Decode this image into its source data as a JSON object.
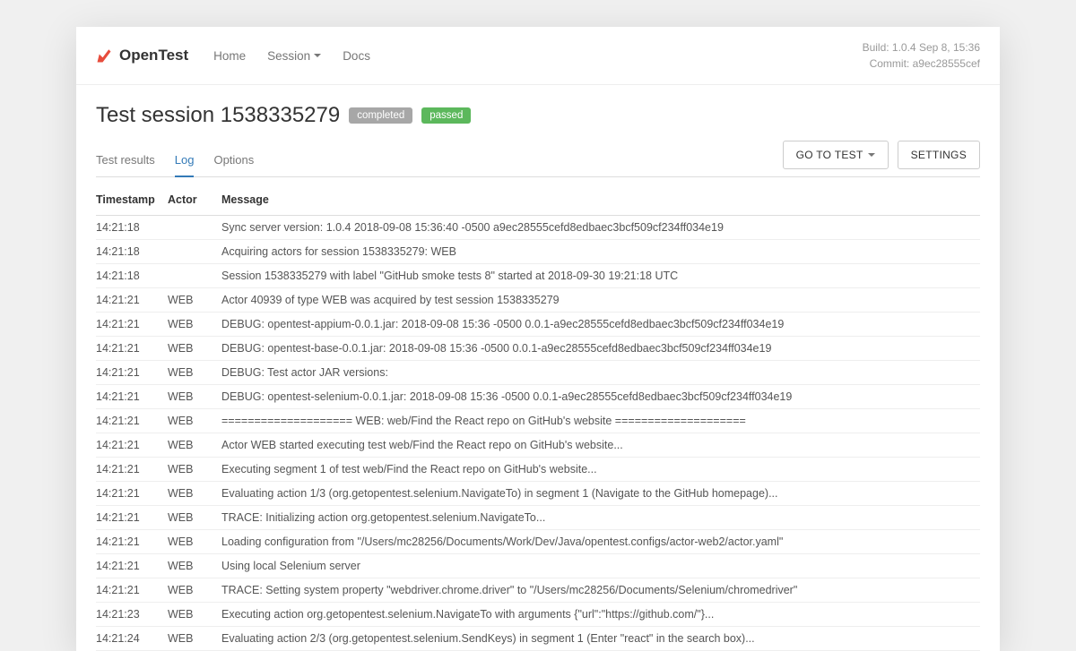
{
  "brand": "OpenTest",
  "nav": {
    "home": "Home",
    "session": "Session",
    "docs": "Docs"
  },
  "meta": {
    "build": "Build: 1.0.4 Sep 8, 15:36",
    "commit": "Commit: a9ec28555cef"
  },
  "title": "Test session 1538335279",
  "badges": {
    "completed": "completed",
    "passed": "passed"
  },
  "tabs": {
    "results": "Test results",
    "log": "Log",
    "options": "Options"
  },
  "buttons": {
    "goToTest": "GO TO TEST",
    "settings": "SETTINGS"
  },
  "headers": {
    "timestamp": "Timestamp",
    "actor": "Actor",
    "message": "Message"
  },
  "log": [
    {
      "ts": "14:21:18",
      "actor": "",
      "msg": "Sync server version: 1.0.4 2018-09-08 15:36:40 -0500 a9ec28555cefd8edbaec3bcf509cf234ff034e19",
      "faded": false
    },
    {
      "ts": "14:21:18",
      "actor": "",
      "msg": "Acquiring actors for session 1538335279: WEB",
      "faded": false
    },
    {
      "ts": "14:21:18",
      "actor": "",
      "msg": "Session 1538335279 with label \"GitHub smoke tests 8\" started at 2018-09-30 19:21:18 UTC",
      "faded": false
    },
    {
      "ts": "14:21:21",
      "actor": "WEB",
      "msg": "Actor 40939 of type WEB was acquired by test session 1538335279",
      "faded": false
    },
    {
      "ts": "14:21:21",
      "actor": "WEB",
      "msg": "DEBUG: opentest-appium-0.0.1.jar: 2018-09-08 15:36 -0500 0.0.1-a9ec28555cefd8edbaec3bcf509cf234ff034e19",
      "faded": false
    },
    {
      "ts": "14:21:21",
      "actor": "WEB",
      "msg": "DEBUG: opentest-base-0.0.1.jar: 2018-09-08 15:36 -0500 0.0.1-a9ec28555cefd8edbaec3bcf509cf234ff034e19",
      "faded": false
    },
    {
      "ts": "14:21:21",
      "actor": "WEB",
      "msg": "DEBUG: Test actor JAR versions:",
      "faded": false
    },
    {
      "ts": "14:21:21",
      "actor": "WEB",
      "msg": "DEBUG: opentest-selenium-0.0.1.jar: 2018-09-08 15:36 -0500 0.0.1-a9ec28555cefd8edbaec3bcf509cf234ff034e19",
      "faded": false
    },
    {
      "ts": "14:21:21",
      "actor": "WEB",
      "msg": "==================== WEB: web/Find the React repo on GitHub's website ====================",
      "faded": false
    },
    {
      "ts": "14:21:21",
      "actor": "WEB",
      "msg": "Actor WEB started executing test web/Find the React repo on GitHub's website...",
      "faded": false
    },
    {
      "ts": "14:21:21",
      "actor": "WEB",
      "msg": "Executing segment 1 of test web/Find the React repo on GitHub's website...",
      "faded": false
    },
    {
      "ts": "14:21:21",
      "actor": "WEB",
      "msg": "Evaluating action 1/3 (org.getopentest.selenium.NavigateTo) in segment 1 (Navigate to the GitHub homepage)...",
      "faded": false
    },
    {
      "ts": "14:21:21",
      "actor": "WEB",
      "msg": "TRACE: Initializing action org.getopentest.selenium.NavigateTo...",
      "faded": true
    },
    {
      "ts": "14:21:21",
      "actor": "WEB",
      "msg": "Loading configuration from \"/Users/mc28256/Documents/Work/Dev/Java/opentest.configs/actor-web2/actor.yaml\"",
      "faded": false
    },
    {
      "ts": "14:21:21",
      "actor": "WEB",
      "msg": "Using local Selenium server",
      "faded": false
    },
    {
      "ts": "14:21:21",
      "actor": "WEB",
      "msg": "TRACE: Setting system property \"webdriver.chrome.driver\" to \"/Users/mc28256/Documents/Selenium/chromedriver\"",
      "faded": true
    },
    {
      "ts": "14:21:23",
      "actor": "WEB",
      "msg": "Executing action org.getopentest.selenium.NavigateTo with arguments {\"url\":\"https://github.com/\"}...",
      "faded": false
    },
    {
      "ts": "14:21:24",
      "actor": "WEB",
      "msg": "Evaluating action 2/3 (org.getopentest.selenium.SendKeys) in segment 1 (Enter \"react\" in the search box)...",
      "faded": false
    }
  ]
}
